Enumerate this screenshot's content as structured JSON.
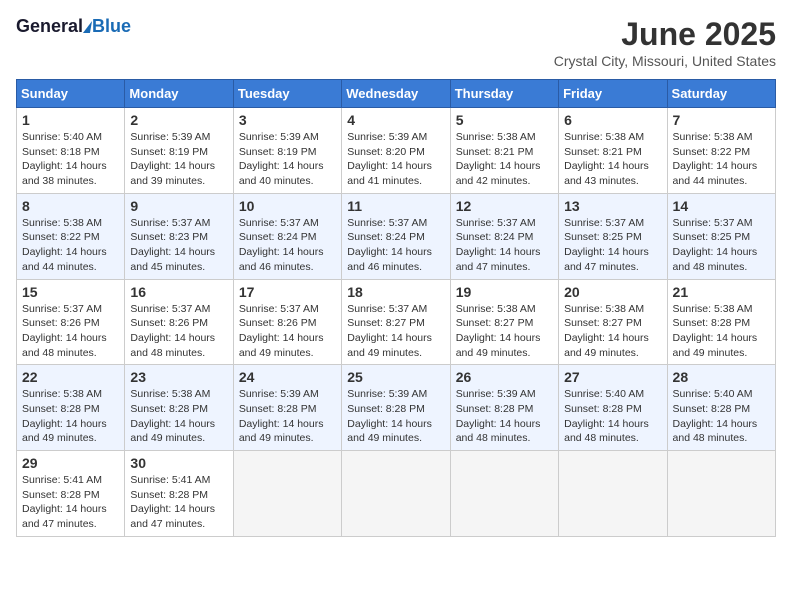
{
  "header": {
    "logo_general": "General",
    "logo_blue": "Blue",
    "month_year": "June 2025",
    "location": "Crystal City, Missouri, United States"
  },
  "calendar": {
    "days_of_week": [
      "Sunday",
      "Monday",
      "Tuesday",
      "Wednesday",
      "Thursday",
      "Friday",
      "Saturday"
    ],
    "weeks": [
      [
        {
          "day": "",
          "empty": true
        },
        {
          "day": "",
          "empty": true
        },
        {
          "day": "",
          "empty": true
        },
        {
          "day": "",
          "empty": true
        },
        {
          "day": "",
          "empty": true
        },
        {
          "day": "",
          "empty": true
        },
        {
          "day": "",
          "empty": true
        }
      ],
      [
        {
          "day": "1",
          "sunrise": "5:40 AM",
          "sunset": "8:18 PM",
          "daylight": "14 hours and 38 minutes."
        },
        {
          "day": "2",
          "sunrise": "5:39 AM",
          "sunset": "8:19 PM",
          "daylight": "14 hours and 39 minutes."
        },
        {
          "day": "3",
          "sunrise": "5:39 AM",
          "sunset": "8:19 PM",
          "daylight": "14 hours and 40 minutes."
        },
        {
          "day": "4",
          "sunrise": "5:39 AM",
          "sunset": "8:20 PM",
          "daylight": "14 hours and 41 minutes."
        },
        {
          "day": "5",
          "sunrise": "5:38 AM",
          "sunset": "8:21 PM",
          "daylight": "14 hours and 42 minutes."
        },
        {
          "day": "6",
          "sunrise": "5:38 AM",
          "sunset": "8:21 PM",
          "daylight": "14 hours and 43 minutes."
        },
        {
          "day": "7",
          "sunrise": "5:38 AM",
          "sunset": "8:22 PM",
          "daylight": "14 hours and 44 minutes."
        }
      ],
      [
        {
          "day": "8",
          "sunrise": "5:38 AM",
          "sunset": "8:22 PM",
          "daylight": "14 hours and 44 minutes."
        },
        {
          "day": "9",
          "sunrise": "5:37 AM",
          "sunset": "8:23 PM",
          "daylight": "14 hours and 45 minutes."
        },
        {
          "day": "10",
          "sunrise": "5:37 AM",
          "sunset": "8:24 PM",
          "daylight": "14 hours and 46 minutes."
        },
        {
          "day": "11",
          "sunrise": "5:37 AM",
          "sunset": "8:24 PM",
          "daylight": "14 hours and 46 minutes."
        },
        {
          "day": "12",
          "sunrise": "5:37 AM",
          "sunset": "8:24 PM",
          "daylight": "14 hours and 47 minutes."
        },
        {
          "day": "13",
          "sunrise": "5:37 AM",
          "sunset": "8:25 PM",
          "daylight": "14 hours and 47 minutes."
        },
        {
          "day": "14",
          "sunrise": "5:37 AM",
          "sunset": "8:25 PM",
          "daylight": "14 hours and 48 minutes."
        }
      ],
      [
        {
          "day": "15",
          "sunrise": "5:37 AM",
          "sunset": "8:26 PM",
          "daylight": "14 hours and 48 minutes."
        },
        {
          "day": "16",
          "sunrise": "5:37 AM",
          "sunset": "8:26 PM",
          "daylight": "14 hours and 48 minutes."
        },
        {
          "day": "17",
          "sunrise": "5:37 AM",
          "sunset": "8:26 PM",
          "daylight": "14 hours and 49 minutes."
        },
        {
          "day": "18",
          "sunrise": "5:37 AM",
          "sunset": "8:27 PM",
          "daylight": "14 hours and 49 minutes."
        },
        {
          "day": "19",
          "sunrise": "5:38 AM",
          "sunset": "8:27 PM",
          "daylight": "14 hours and 49 minutes."
        },
        {
          "day": "20",
          "sunrise": "5:38 AM",
          "sunset": "8:27 PM",
          "daylight": "14 hours and 49 minutes."
        },
        {
          "day": "21",
          "sunrise": "5:38 AM",
          "sunset": "8:28 PM",
          "daylight": "14 hours and 49 minutes."
        }
      ],
      [
        {
          "day": "22",
          "sunrise": "5:38 AM",
          "sunset": "8:28 PM",
          "daylight": "14 hours and 49 minutes."
        },
        {
          "day": "23",
          "sunrise": "5:38 AM",
          "sunset": "8:28 PM",
          "daylight": "14 hours and 49 minutes."
        },
        {
          "day": "24",
          "sunrise": "5:39 AM",
          "sunset": "8:28 PM",
          "daylight": "14 hours and 49 minutes."
        },
        {
          "day": "25",
          "sunrise": "5:39 AM",
          "sunset": "8:28 PM",
          "daylight": "14 hours and 49 minutes."
        },
        {
          "day": "26",
          "sunrise": "5:39 AM",
          "sunset": "8:28 PM",
          "daylight": "14 hours and 48 minutes."
        },
        {
          "day": "27",
          "sunrise": "5:40 AM",
          "sunset": "8:28 PM",
          "daylight": "14 hours and 48 minutes."
        },
        {
          "day": "28",
          "sunrise": "5:40 AM",
          "sunset": "8:28 PM",
          "daylight": "14 hours and 48 minutes."
        }
      ],
      [
        {
          "day": "29",
          "sunrise": "5:41 AM",
          "sunset": "8:28 PM",
          "daylight": "14 hours and 47 minutes."
        },
        {
          "day": "30",
          "sunrise": "5:41 AM",
          "sunset": "8:28 PM",
          "daylight": "14 hours and 47 minutes."
        },
        {
          "day": "",
          "empty": true
        },
        {
          "day": "",
          "empty": true
        },
        {
          "day": "",
          "empty": true
        },
        {
          "day": "",
          "empty": true
        },
        {
          "day": "",
          "empty": true
        }
      ]
    ]
  }
}
